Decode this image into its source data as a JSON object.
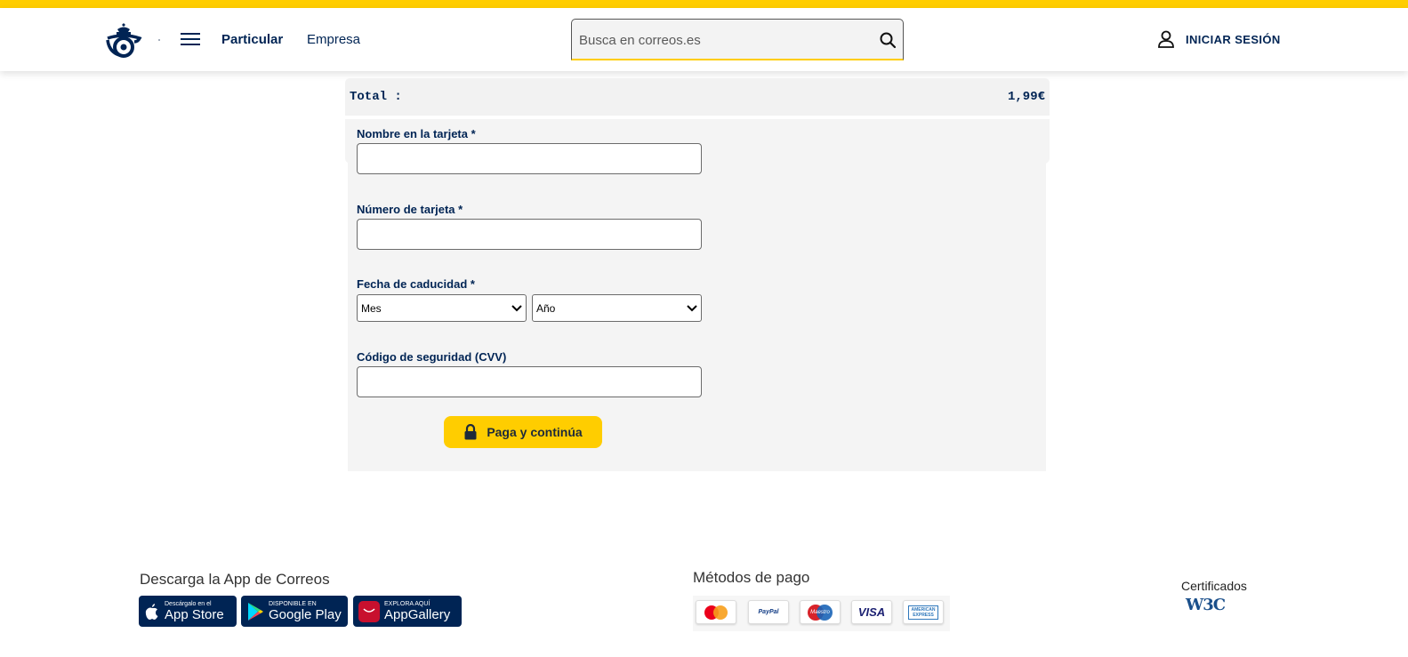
{
  "header": {
    "nav": {
      "particular": "Particular",
      "empresa": "Empresa"
    },
    "search": {
      "placeholder": "Busca en correos.es",
      "value": ""
    },
    "login_label": "INICIAR SESIÓN"
  },
  "summary": {
    "total_label": "Total :",
    "total_value": "1,99€"
  },
  "form": {
    "name_label": "Nombre en la tarjeta *",
    "number_label": "Número de tarjeta *",
    "expiry_label": "Fecha de caducidad *",
    "month_selected": "Mes",
    "year_selected": "Año",
    "cvv_label": "Código de seguridad (CVV)",
    "submit_label": "Paga y continúa"
  },
  "footer": {
    "app_title": "Descarga la App de Correos",
    "stores": [
      {
        "small": "Descárgalo en el",
        "big": "App Store"
      },
      {
        "small": "DISPONIBLE EN",
        "big": "Google Play"
      },
      {
        "small": "EXPLORA AQUÍ",
        "big": "AppGallery"
      }
    ],
    "payment_title": "Métodos de pago",
    "payment_methods": [
      "PayPal",
      "Maestro",
      "VISA",
      "AMERICAN EXPRESS"
    ],
    "cert_title": "Certificados",
    "cert_logo": "W3C"
  },
  "colors": {
    "brand_yellow": "#ffcd00",
    "brand_navy": "#002454"
  }
}
